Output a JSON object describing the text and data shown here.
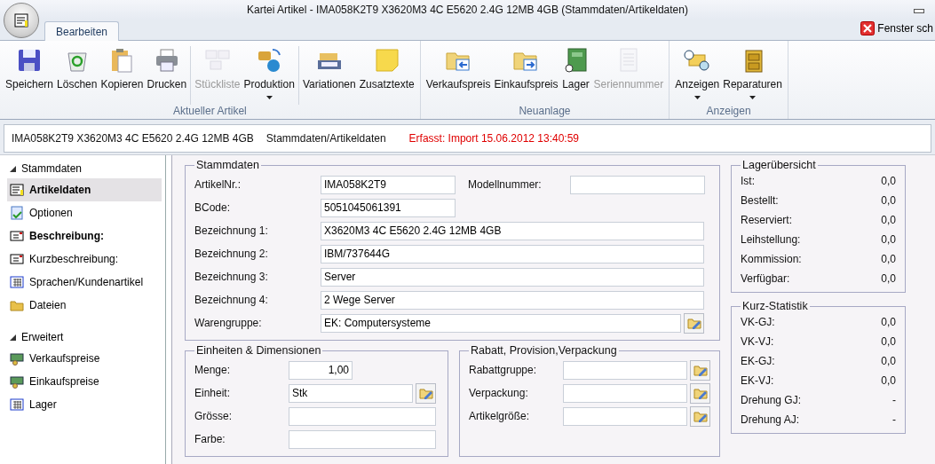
{
  "window": {
    "title": "Kartei Artikel - IMA058K2T9 X3620M3 4C E5620 2.4G 12MB 4GB (Stammdaten/Artikeldaten)",
    "close_label": "Fenster sch"
  },
  "tabs": [
    {
      "label": "Bearbeiten",
      "selected": true
    }
  ],
  "ribbon": [
    {
      "title": "Aktueller Artikel",
      "clusters": [
        [
          {
            "label": "Speichern",
            "disabled": false,
            "dropdown": false
          },
          {
            "label": "Löschen",
            "disabled": false,
            "dropdown": false
          },
          {
            "label": "Kopieren",
            "disabled": false,
            "dropdown": false
          },
          {
            "label": "Drucken",
            "disabled": false,
            "dropdown": false
          }
        ],
        [
          {
            "label": "Stückliste",
            "disabled": true,
            "dropdown": false
          },
          {
            "label": "Produktion",
            "disabled": false,
            "dropdown": true
          }
        ],
        [
          {
            "label": "Variationen",
            "disabled": false,
            "dropdown": false
          },
          {
            "label": "Zusatztexte",
            "disabled": false,
            "dropdown": false
          }
        ]
      ]
    },
    {
      "title": "Neuanlage",
      "clusters": [
        [
          {
            "label": "Verkaufspreis",
            "disabled": false,
            "dropdown": false
          },
          {
            "label": "Einkaufspreis",
            "disabled": false,
            "dropdown": false
          },
          {
            "label": "Lager",
            "disabled": false,
            "dropdown": false
          },
          {
            "label": "Seriennummer",
            "disabled": true,
            "dropdown": false
          }
        ]
      ]
    },
    {
      "title": "Anzeigen",
      "clusters": [
        [
          {
            "label": "Anzeigen",
            "disabled": false,
            "dropdown": true
          },
          {
            "label": "Reparaturen",
            "disabled": false,
            "dropdown": true
          }
        ]
      ]
    }
  ],
  "info_bar": {
    "article": "IMA058K2T9 X3620M3 4C E5620 2.4G 12MB 4GB",
    "path": "Stammdaten/Artikeldaten",
    "created": "Erfasst: Import 15.06.2012 13:40:59"
  },
  "sidebar": [
    {
      "title": "Stammdaten",
      "expanded": true,
      "items": [
        {
          "label": "Artikeldaten",
          "selected": true,
          "emphasized": true
        },
        {
          "label": "Optionen",
          "selected": false,
          "emphasized": false
        },
        {
          "label": "Beschreibung:",
          "selected": false,
          "emphasized": true
        },
        {
          "label": "Kurzbeschreibung:",
          "selected": false,
          "emphasized": false
        },
        {
          "label": "Sprachen/Kundenartikel",
          "selected": false,
          "emphasized": false
        },
        {
          "label": "Dateien",
          "selected": false,
          "emphasized": false
        }
      ]
    },
    {
      "title": "Erweitert",
      "expanded": true,
      "items": [
        {
          "label": "Verkaufspreise",
          "selected": false,
          "emphasized": false
        },
        {
          "label": "Einkaufspreise",
          "selected": false,
          "emphasized": false
        },
        {
          "label": "Lager",
          "selected": false,
          "emphasized": false
        }
      ]
    }
  ],
  "stammdaten": {
    "title": "Stammdaten",
    "rows": [
      [
        {
          "label": "ArtikelNr.:",
          "value": "IMA058K2T9",
          "kind": "short"
        },
        {
          "label": "Modellnummer:",
          "kind": "short"
        }
      ],
      [
        {
          "label": "BCode:",
          "value": "5051045061391",
          "kind": "short"
        }
      ],
      [
        {
          "label": "Bezeichnung 1:",
          "value": "X3620M3 4C E5620 2.4G 12MB 4GB",
          "kind": "wide"
        }
      ],
      [
        {
          "label": "Bezeichnung 2:",
          "value": "IBM/737644G",
          "kind": "wide"
        }
      ],
      [
        {
          "label": "Bezeichnung 3:",
          "value": "Server",
          "kind": "wide"
        }
      ],
      [
        {
          "label": "Bezeichnung 4:",
          "value": "2 Wege Server",
          "kind": "wide"
        }
      ],
      [
        {
          "label": "Warengruppe:",
          "value": "EK: Computersysteme",
          "kind": "lookup"
        }
      ]
    ]
  },
  "einheiten": {
    "title": "Einheiten & Dimensionen",
    "fields": [
      {
        "label": "Menge:",
        "value": "1,00",
        "kind": "number"
      },
      {
        "label": "Einheit:",
        "value": "Stk",
        "kind": "lookup"
      },
      {
        "label": "Grösse:",
        "kind": "wide"
      },
      {
        "label": "Farbe:",
        "kind": "wide"
      }
    ]
  },
  "rabatt": {
    "title": "Rabatt, Provision,Verpackung",
    "fields": [
      {
        "label": "Rabattgruppe:",
        "kind": "lookup"
      },
      {
        "label": "Verpackung:",
        "kind": "lookup"
      },
      {
        "label": "Artikelgröße:",
        "kind": "lookup"
      }
    ]
  },
  "lager": {
    "title": "Lagerübersicht",
    "rows": [
      {
        "label": "Ist:",
        "value": "0,0"
      },
      {
        "label": "Bestellt:",
        "value": "0,0"
      },
      {
        "label": "Reserviert:",
        "value": "0,0"
      },
      {
        "label": "Leihstellung:",
        "value": "0,0"
      },
      {
        "label": "Kommission:",
        "value": "0,0"
      },
      {
        "label": "Verfügbar:",
        "value": "0,0"
      }
    ]
  },
  "statistik": {
    "title": "Kurz-Statistik",
    "rows": [
      {
        "label": "VK-GJ:",
        "value": "0,0"
      },
      {
        "label": "VK-VJ:",
        "value": "0,0"
      },
      {
        "label": "EK-GJ:",
        "value": "0,0"
      },
      {
        "label": "EK-VJ:",
        "value": "0,0"
      },
      {
        "label": "Drehung GJ:",
        "value": "-"
      },
      {
        "label": "Drehung AJ:",
        "value": "-"
      }
    ]
  }
}
